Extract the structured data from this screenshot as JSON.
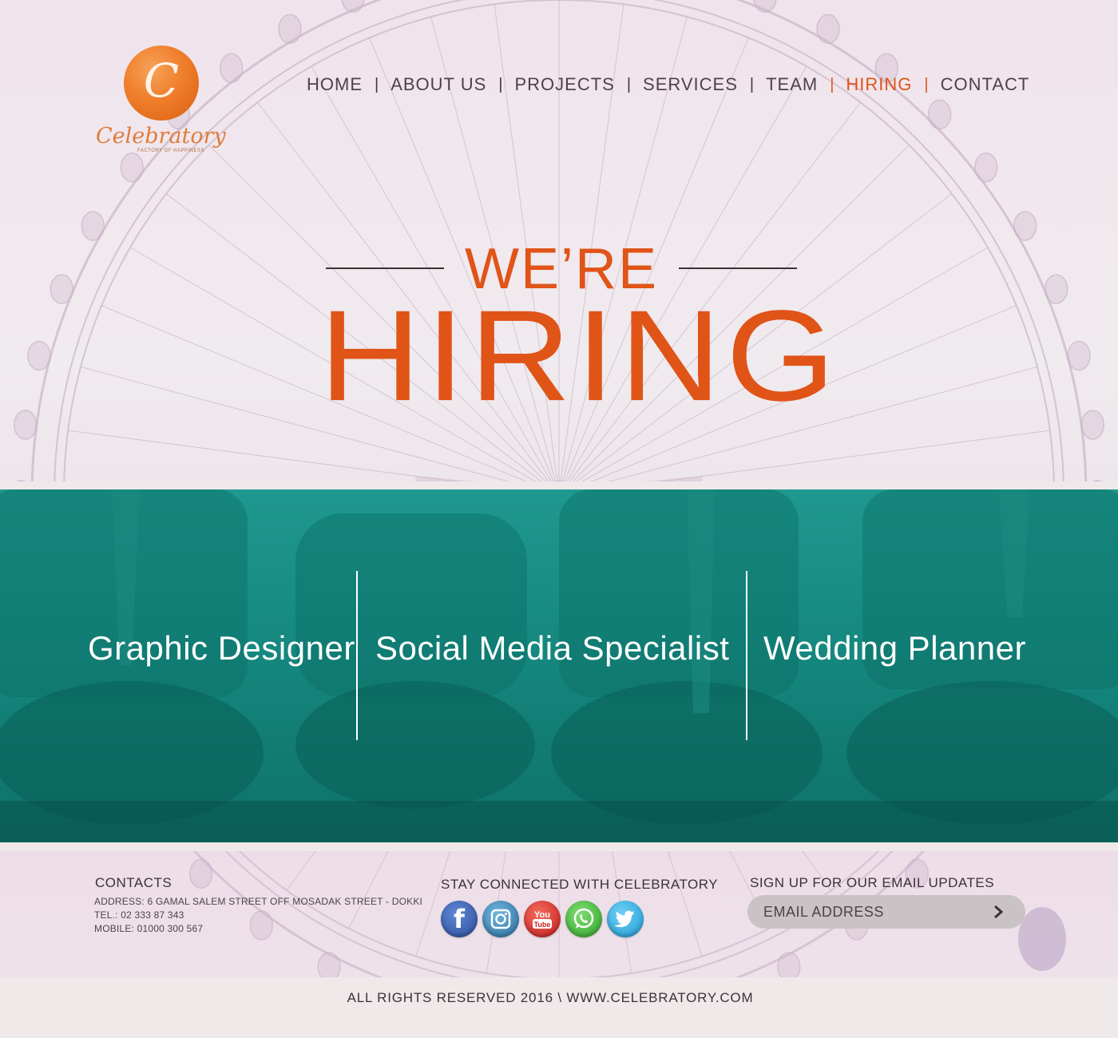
{
  "logo": {
    "letter": "C",
    "name": "Celebratory",
    "tagline": "FACTORY OF HAPPINESS"
  },
  "nav": {
    "items": [
      {
        "label": "HOME",
        "active": false
      },
      {
        "label": "ABOUT US",
        "active": false
      },
      {
        "label": "PROJECTS",
        "active": false
      },
      {
        "label": "SERVICES",
        "active": false
      },
      {
        "label": "TEAM",
        "active": false
      },
      {
        "label": "HIRING",
        "active": true
      },
      {
        "label": "CONTACT",
        "active": false
      }
    ],
    "separator": "|"
  },
  "hero": {
    "line1": "WE’RE",
    "line2": "HIRING"
  },
  "jobs": [
    {
      "title": "Graphic Designer"
    },
    {
      "title": "Social Media Specialist"
    },
    {
      "title": "Wedding Planner"
    }
  ],
  "footer": {
    "contacts": {
      "title": "CONTACTS",
      "address": "ADDRESS: 6 GAMAL SALEM STREET OFF MOSADAK STREET - DOKKI",
      "tel": "TEL.: 02 333 87 343",
      "mobile": "MOBILE: 01000 300 567"
    },
    "social": {
      "title": "STAY CONNECTED WITH CELEBRATORY",
      "icons": [
        "facebook-icon",
        "instagram-icon",
        "youtube-icon",
        "whatsapp-icon",
        "twitter-icon"
      ],
      "fb_glyph": "f",
      "yt_line1": "You",
      "yt_line2": "Tube"
    },
    "newsletter": {
      "title": "SIGN UP FOR OUR EMAIL UPDATES",
      "placeholder": "EMAIL ADDRESS"
    },
    "copyright": "ALL RIGHTS RESERVED 2016 \\ WWW.CELEBRATORY.COM"
  },
  "colors": {
    "accent": "#e05418",
    "teal": "#15887f",
    "text_dark": "#3b3336"
  }
}
